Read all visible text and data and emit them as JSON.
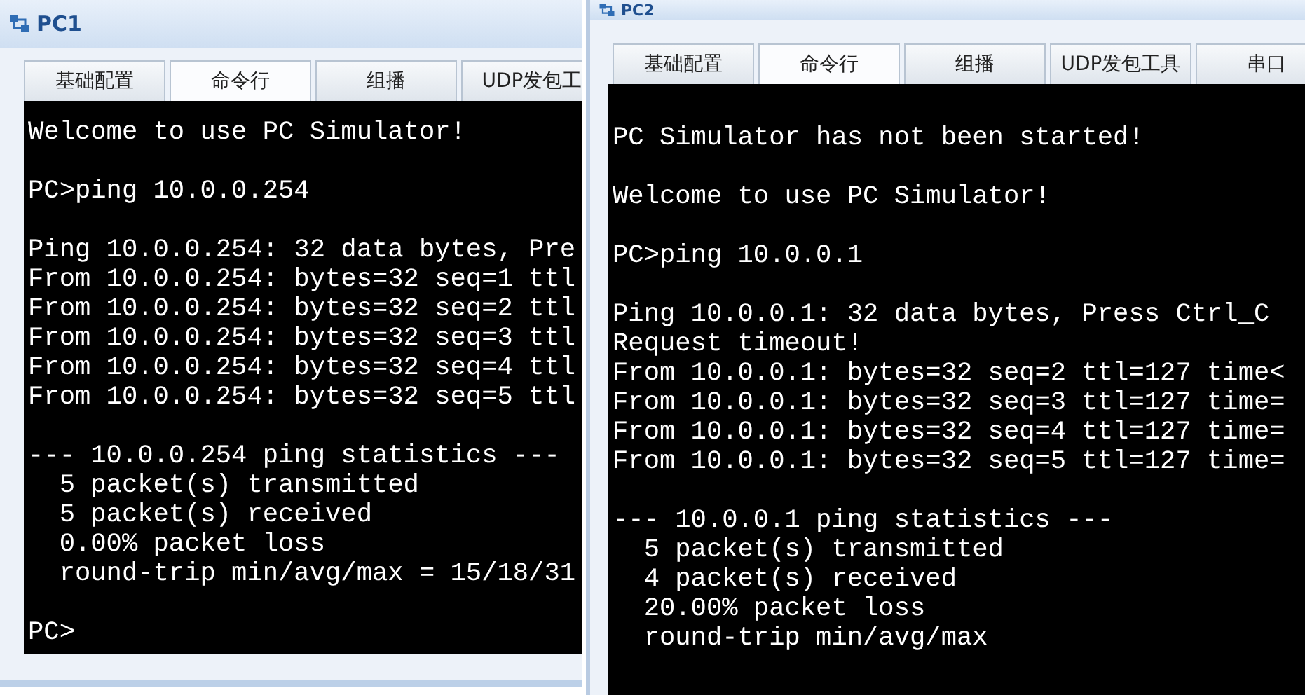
{
  "windows": [
    {
      "title": "PC1",
      "tabs": [
        {
          "label": "基础配置",
          "selected": false
        },
        {
          "label": "命令行",
          "selected": true
        },
        {
          "label": "组播",
          "selected": false
        },
        {
          "label": "UDP发包工",
          "selected": false
        }
      ],
      "terminal_blocks": [
        [
          "Welcome to use PC Simulator!"
        ],
        [
          "PC>ping 10.0.0.254"
        ],
        [
          "Ping 10.0.0.254: 32 data bytes, Pre",
          "From 10.0.0.254: bytes=32 seq=1 ttl",
          "From 10.0.0.254: bytes=32 seq=2 ttl",
          "From 10.0.0.254: bytes=32 seq=3 ttl",
          "From 10.0.0.254: bytes=32 seq=4 ttl",
          "From 10.0.0.254: bytes=32 seq=5 ttl"
        ],
        [
          "--- 10.0.0.254 ping statistics ---",
          "  5 packet(s) transmitted",
          "  5 packet(s) received",
          "  0.00% packet loss",
          "  round-trip min/avg/max = 15/18/31"
        ],
        [
          "PC>"
        ]
      ]
    },
    {
      "title": "PC2",
      "tabs": [
        {
          "label": "基础配置",
          "selected": false
        },
        {
          "label": "命令行",
          "selected": true
        },
        {
          "label": "组播",
          "selected": false
        },
        {
          "label": "UDP发包工具",
          "selected": false
        },
        {
          "label": "串口",
          "selected": false
        }
      ],
      "terminal_blocks": [
        [
          "PC Simulator has not been started!"
        ],
        [
          "Welcome to use PC Simulator!"
        ],
        [
          "PC>ping 10.0.0.1"
        ],
        [
          "Ping 10.0.0.1: 32 data bytes, Press Ctrl_C",
          "Request timeout!",
          "From 10.0.0.1: bytes=32 seq=2 ttl=127 time<",
          "From 10.0.0.1: bytes=32 seq=3 ttl=127 time=",
          "From 10.0.0.1: bytes=32 seq=4 ttl=127 time=",
          "From 10.0.0.1: bytes=32 seq=5 ttl=127 time="
        ],
        [
          "--- 10.0.0.1 ping statistics ---",
          "  5 packet(s) transmitted",
          "  4 packet(s) received",
          "  20.00% packet loss",
          "  round-trip min/avg/max"
        ]
      ]
    }
  ]
}
